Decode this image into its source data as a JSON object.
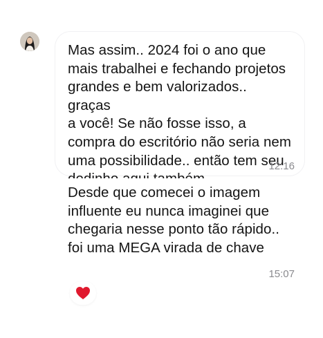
{
  "chat": {
    "messages": [
      {
        "text": "Mas assim.. 2024 foi o ano que\nmais trabalhei e fechando projetos\ngrandes e bem valorizados.. graças\na você! Se não fosse isso, a\ncompra do escritório não seria nem\numa possibilidade.. então tem seu\ndedinho aqui também",
        "time": "12:16"
      },
      {
        "text": "Desde que comecei o imagem\ninfluente eu nunca imaginei que\nchegaria nesse ponto tão rápido..\nfoi uma MEGA virada de chave",
        "time": "15:07"
      }
    ],
    "reaction": {
      "icon": "red-heart-icon",
      "color": "#e0192e"
    }
  }
}
